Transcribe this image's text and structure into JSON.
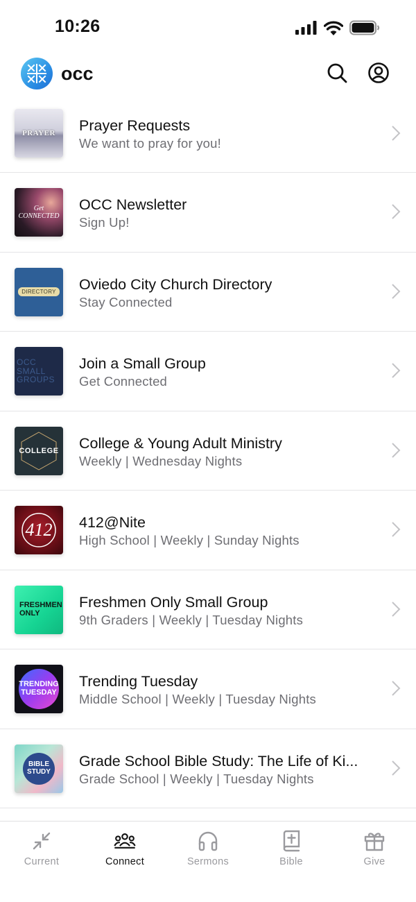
{
  "status": {
    "time": "10:26"
  },
  "header": {
    "title": "occ"
  },
  "items": [
    {
      "title": "Prayer Requests",
      "subtitle": "We want to pray for you!",
      "thumb_text": "PRAYER"
    },
    {
      "title": "OCC Newsletter",
      "subtitle": "Sign Up!",
      "thumb_text": "Get CONNECTED"
    },
    {
      "title": "Oviedo City Church Directory",
      "subtitle": "Stay Connected",
      "thumb_text": "DIRECTORY"
    },
    {
      "title": "Join a Small Group",
      "subtitle": "Get Connected",
      "thumb_text": "OCC SMALL GROUPS"
    },
    {
      "title": "College & Young Adult Ministry",
      "subtitle": "Weekly | Wednesday Nights",
      "thumb_text": "COLLEGE"
    },
    {
      "title": "412@Nite",
      "subtitle": "High School | Weekly | Sunday Nights",
      "thumb_text": "412"
    },
    {
      "title": "Freshmen Only Small Group",
      "subtitle": "9th Graders | Weekly | Tuesday Nights",
      "thumb_text": "FRESHMEN ONLY"
    },
    {
      "title": "Trending Tuesday",
      "subtitle": "Middle School | Weekly | Tuesday Nights",
      "thumb_text": "TRENDING TUESDAY"
    },
    {
      "title": "Grade School Bible Study: The Life of Ki...",
      "subtitle": "Grade School | Weekly | Tuesday Nights",
      "thumb_text": "BIBLE STUDY"
    }
  ],
  "tabs": [
    {
      "label": "Current",
      "icon": "compress-arrows-icon",
      "active": false
    },
    {
      "label": "Connect",
      "icon": "people-group-icon",
      "active": true
    },
    {
      "label": "Sermons",
      "icon": "headphones-icon",
      "active": false
    },
    {
      "label": "Bible",
      "icon": "bible-icon",
      "active": false
    },
    {
      "label": "Give",
      "icon": "gift-icon",
      "active": false
    }
  ],
  "colors": {
    "accent": "#2b8fe4",
    "active_tab": "#111111",
    "inactive_tab": "#9a9a9e",
    "subtitle": "#6e6e73"
  }
}
